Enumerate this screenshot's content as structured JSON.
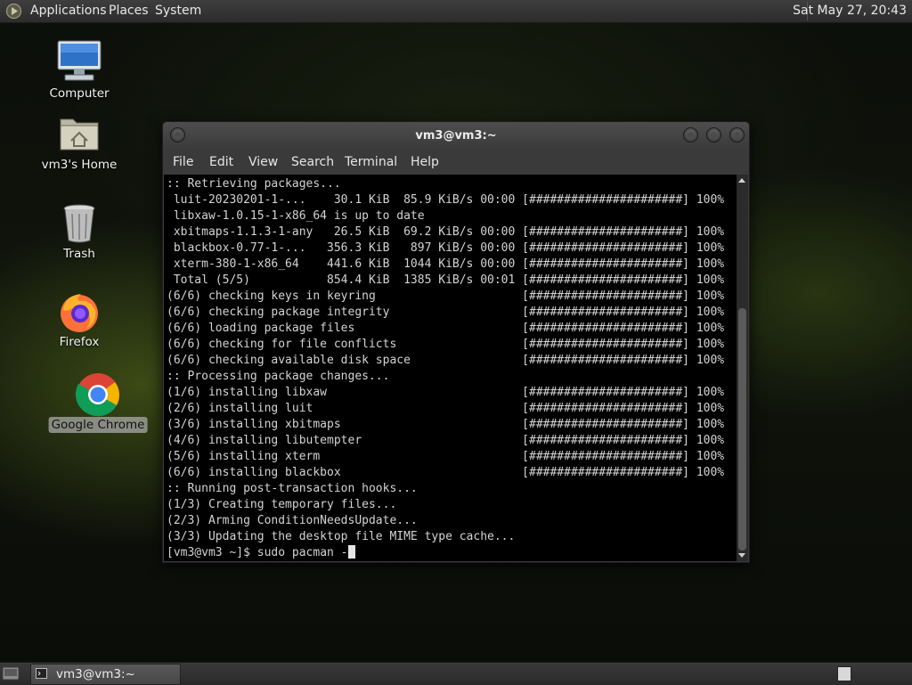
{
  "top_panel": {
    "menus": [
      "Applications",
      "Places",
      "System"
    ],
    "clock": "Sat May 27, 20:43"
  },
  "desktop_icons": [
    {
      "label": "Computer",
      "icon": "computer-icon"
    },
    {
      "label": "vm3's Home",
      "icon": "home-folder-icon"
    },
    {
      "label": "Trash",
      "icon": "trash-icon"
    },
    {
      "label": "Firefox",
      "icon": "firefox-icon"
    },
    {
      "label": "Google Chrome",
      "icon": "chrome-icon"
    }
  ],
  "terminal": {
    "title": "vm3@vm3:~",
    "menu": [
      "File",
      "Edit",
      "View",
      "Search",
      "Terminal",
      "Help"
    ],
    "lines": [
      ":: Retrieving packages...",
      " luit-20230201-1-...    30.1 KiB  85.9 KiB/s 00:00 [######################] 100%",
      " libxaw-1.0.15-1-x86_64 is up to date",
      " xbitmaps-1.1.3-1-any   26.5 KiB  69.2 KiB/s 00:00 [######################] 100%",
      " blackbox-0.77-1-...   356.3 KiB   897 KiB/s 00:00 [######################] 100%",
      " xterm-380-1-x86_64    441.6 KiB  1044 KiB/s 00:00 [######################] 100%",
      " Total (5/5)           854.4 KiB  1385 KiB/s 00:01 [######################] 100%",
      "(6/6) checking keys in keyring                     [######################] 100%",
      "(6/6) checking package integrity                   [######################] 100%",
      "(6/6) loading package files                        [######################] 100%",
      "(6/6) checking for file conflicts                  [######################] 100%",
      "(6/6) checking available disk space                [######################] 100%",
      ":: Processing package changes...",
      "(1/6) installing libxaw                            [######################] 100%",
      "(2/6) installing luit                              [######################] 100%",
      "(3/6) installing xbitmaps                          [######################] 100%",
      "(4/6) installing libutempter                       [######################] 100%",
      "(5/6) installing xterm                             [######################] 100%",
      "(6/6) installing blackbox                          [######################] 100%",
      ":: Running post-transaction hooks...",
      "(1/3) Creating temporary files...",
      "(2/3) Arming ConditionNeedsUpdate...",
      "(3/3) Updating the desktop file MIME type cache..."
    ],
    "prompt": "[vm3@vm3 ~]$ ",
    "command": "sudo pacman -"
  },
  "bottom_panel": {
    "task_label": "vm3@vm3:~"
  }
}
